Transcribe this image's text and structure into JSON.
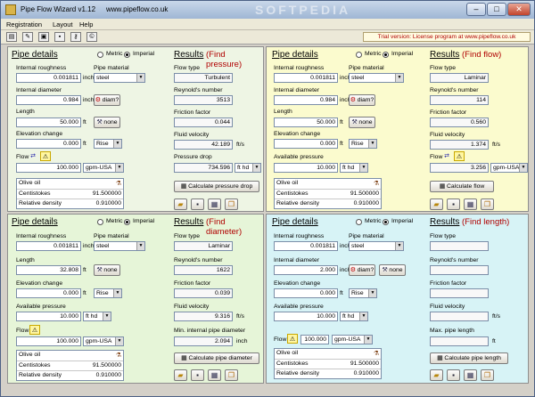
{
  "window": {
    "title": "Pipe Flow Wizard v1.12",
    "url": "www.pipeflow.co.uk",
    "watermark": "SOFTPEDIA"
  },
  "menu": [
    "Registration",
    "Layout",
    "Help"
  ],
  "trial_notice": "Trial version: License program at www.pipeflow.co.uk",
  "common": {
    "pipe_details": "Pipe details",
    "metric": "Metric",
    "imperial": "Imperial",
    "results": "Results",
    "flow_type": "Flow type",
    "reynolds": "Reynold's number",
    "friction": "Friction factor",
    "fluid_velocity": "Fluid velocity",
    "internal_roughness": "Internal roughness",
    "pipe_material": "Pipe material",
    "internal_diameter": "Internal diameter",
    "length": "Length",
    "elevation_change": "Elevation change",
    "available_pressure": "Available pressure",
    "flow": "Flow",
    "inch": "inch",
    "ft": "ft",
    "fts": "ft/s",
    "diam_btn": "diam?",
    "none_btn": "none",
    "centistokes": "Centistokes",
    "relative_density": "Relative density"
  },
  "q1": {
    "mode": "(Find pressure)",
    "roughness": "0.001811",
    "material": "steel",
    "diameter": "0.984",
    "length": "50.000",
    "elevation": "0.000",
    "rise": "Rise",
    "flow": "100.000",
    "flow_unit": "gpm-USA",
    "fluid": "Olive oil",
    "centistokes": "91.500000",
    "density": "0.910000",
    "flow_type": "Turbulent",
    "reynolds": "3513",
    "friction": "0.044",
    "velocity": "42.189",
    "out_label": "Pressure drop",
    "out_value": "734.596",
    "out_unit": "ft hd",
    "calc_btn": "Calculate pressure drop"
  },
  "q2": {
    "mode": "(Find flow)",
    "roughness": "0.001811",
    "material": "steel",
    "diameter": "0.984",
    "length": "50.000",
    "elevation": "0.000",
    "rise": "Rise",
    "pressure": "10.000",
    "pressure_unit": "ft hd",
    "fluid": "Olive oil",
    "centistokes": "91.500000",
    "density": "0.910000",
    "flow_type": "Laminar",
    "reynolds": "114",
    "friction": "0.560",
    "velocity": "1.374",
    "flow": "3.256",
    "flow_unit": "gpm-USA",
    "calc_btn": "Calculate flow"
  },
  "q3": {
    "mode": "(Find diameter)",
    "roughness": "0.001811",
    "material": "steel",
    "length": "32.808",
    "elevation": "0.000",
    "rise": "Rise",
    "pressure": "10.000",
    "pressure_unit": "ft hd",
    "flow": "100.000",
    "flow_unit": "gpm-USA",
    "fluid": "Olive oil",
    "centistokes": "91.500000",
    "density": "0.910000",
    "flow_type": "Laminar",
    "reynolds": "1622",
    "friction": "0.039",
    "velocity": "9.316",
    "out_label": "Min. internal pipe diameter",
    "out_value": "2.094",
    "out_unit": "inch",
    "calc_btn": "Calculate pipe diameter"
  },
  "q4": {
    "mode": "(Find length)",
    "roughness": "0.001811",
    "material": "steel",
    "diameter": "2.000",
    "elevation": "0.000",
    "rise": "Rise",
    "pressure": "10.000",
    "pressure_unit": "ft hd",
    "flow": "100.000",
    "flow_unit": "gpm-USA",
    "fluid": "Olive oil",
    "centistokes": "91.500000",
    "density": "0.910000",
    "out_label": "Max. pipe length",
    "out_unit": "ft",
    "calc_btn": "Calculate pipe length"
  },
  "colors": {
    "q1": "#eef5e4",
    "q2": "#fbfbce",
    "q3": "#e6f5d8",
    "q4": "#d7f3f6",
    "accent": "#b00000"
  },
  "icons": {
    "toolbar": [
      "printer-icon",
      "tools-icon",
      "picture-icon",
      "save-icon",
      "lock-icon",
      "copyright-icon"
    ],
    "section": [
      "folder-open-icon",
      "save-icon",
      "table-icon",
      "copy-icon"
    ]
  }
}
